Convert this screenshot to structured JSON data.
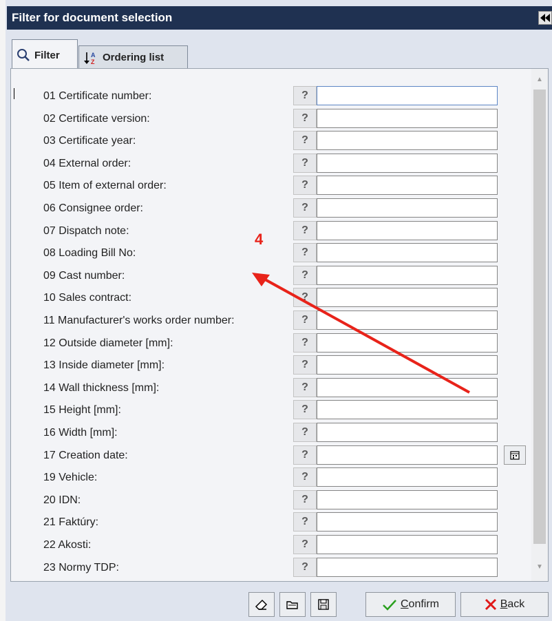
{
  "window": {
    "title": "Filter for document selection",
    "collapse_icon": "double-left-arrow-icon"
  },
  "tabs": [
    {
      "label": "Filter",
      "icon": "search-icon",
      "active": true
    },
    {
      "label": "Ordering list",
      "icon": "sort-az-icon",
      "active": false
    }
  ],
  "fields": [
    {
      "label": "01 Certificate number:",
      "value": ""
    },
    {
      "label": "02 Certificate version:",
      "value": ""
    },
    {
      "label": "03 Certificate year:",
      "value": ""
    },
    {
      "label": "04 External  order:",
      "value": ""
    },
    {
      "label": "05 Item of  external order:",
      "value": ""
    },
    {
      "label": "06 Consignee order:",
      "value": ""
    },
    {
      "label": "07 Dispatch note:",
      "value": ""
    },
    {
      "label": "08 Loading  Bill No:",
      "value": ""
    },
    {
      "label": "09 Cast number:",
      "value": ""
    },
    {
      "label": "10 Sales contract:",
      "value": ""
    },
    {
      "label": "11 Manufacturer's works order number:",
      "value": ""
    },
    {
      "label": "12 Outside  diameter [mm]:",
      "value": ""
    },
    {
      "label": "13 Inside  diameter [mm]:",
      "value": ""
    },
    {
      "label": "14 Wall thickness [mm]:",
      "value": ""
    },
    {
      "label": "15 Height  [mm]:",
      "value": ""
    },
    {
      "label": "16 Width  [mm]:",
      "value": ""
    },
    {
      "label": "17 Creation  date:",
      "value": ""
    },
    {
      "label": "19 Vehicle:",
      "value": ""
    },
    {
      "label": "20 IDN:",
      "value": ""
    },
    {
      "label": "21 Faktúry:",
      "value": ""
    },
    {
      "label": "22 Akosti:",
      "value": ""
    },
    {
      "label": "23 Normy TDP:",
      "value": ""
    }
  ],
  "help_symbol": "?",
  "annotation": {
    "number": "4",
    "color": "#e8231a"
  },
  "toolbar": {
    "confirm_label": "onfirm",
    "confirm_mnemonic": "C",
    "back_label": "ack",
    "back_mnemonic": "B",
    "icons": [
      "eraser-icon",
      "open-folder-icon",
      "save-icon"
    ]
  }
}
